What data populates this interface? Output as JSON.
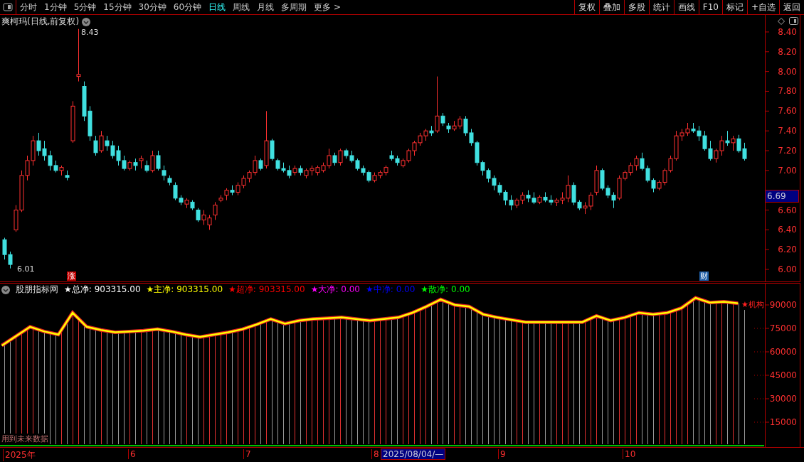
{
  "toolbar": {
    "periods": [
      {
        "label": "分时",
        "selected": false
      },
      {
        "label": "1分钟",
        "selected": false
      },
      {
        "label": "5分钟",
        "selected": false
      },
      {
        "label": "15分钟",
        "selected": false
      },
      {
        "label": "30分钟",
        "selected": false
      },
      {
        "label": "60分钟",
        "selected": false
      },
      {
        "label": "日线",
        "selected": true
      },
      {
        "label": "周线",
        "selected": false
      },
      {
        "label": "月线",
        "selected": false
      },
      {
        "label": "多周期",
        "selected": false
      }
    ],
    "more": "更多 >",
    "buttons": [
      "复权",
      "叠加",
      "多股",
      "统计",
      "画线",
      "F10",
      "标记",
      "+自选",
      "返回"
    ]
  },
  "main_chart": {
    "title": "爽柯玛(日线,前复权)",
    "current_price": "6.69",
    "high_label": "8.43",
    "low_label": "6.01",
    "markers": [
      {
        "text": "涨",
        "color": "#c00000"
      },
      {
        "text": "财",
        "color": "#1f5fa8"
      }
    ],
    "chart_data": {
      "type": "candlestick",
      "ylim": [
        5.871,
        8.572
      ],
      "yticks": [
        {
          "value": 8.4,
          "label": "8.40"
        },
        {
          "value": 8.2,
          "label": "8.20"
        },
        {
          "value": 8.0,
          "label": "8.00"
        },
        {
          "value": 7.8,
          "label": "7.80"
        },
        {
          "value": 7.6,
          "label": "7.60"
        },
        {
          "value": 7.4,
          "label": "7.40"
        },
        {
          "value": 7.2,
          "label": "7.20"
        },
        {
          "value": 7.0,
          "label": "7.00"
        },
        {
          "value": 6.6,
          "label": "6.60"
        },
        {
          "value": 6.4,
          "label": "6.40"
        },
        {
          "value": 6.2,
          "label": "6.20"
        },
        {
          "value": 6.0,
          "label": "6.00"
        }
      ],
      "ohlc": [
        [
          6.3,
          6.32,
          6.1,
          6.15
        ],
        [
          6.15,
          6.18,
          6.01,
          6.05
        ],
        [
          6.4,
          6.65,
          6.38,
          6.6
        ],
        [
          6.6,
          7.0,
          6.58,
          6.95
        ],
        [
          6.95,
          7.15,
          6.9,
          7.1
        ],
        [
          7.1,
          7.35,
          7.05,
          7.3
        ],
        [
          7.3,
          7.38,
          7.15,
          7.2
        ],
        [
          7.22,
          7.3,
          7.1,
          7.15
        ],
        [
          7.15,
          7.2,
          7.0,
          7.05
        ],
        [
          7.05,
          7.1,
          6.98,
          7.0
        ],
        [
          7.0,
          7.05,
          6.95,
          7.03
        ],
        [
          6.95,
          7.0,
          6.9,
          6.93
        ],
        [
          7.3,
          7.7,
          7.28,
          7.65
        ],
        [
          7.95,
          8.43,
          7.9,
          7.97
        ],
        [
          7.85,
          7.9,
          7.5,
          7.55
        ],
        [
          7.6,
          7.65,
          7.3,
          7.35
        ],
        [
          7.3,
          7.35,
          7.15,
          7.18
        ],
        [
          7.2,
          7.4,
          7.18,
          7.35
        ],
        [
          7.3,
          7.35,
          7.2,
          7.25
        ],
        [
          7.25,
          7.3,
          7.12,
          7.15
        ],
        [
          7.2,
          7.25,
          7.05,
          7.1
        ],
        [
          7.1,
          7.15,
          7.0,
          7.02
        ],
        [
          7.02,
          7.1,
          7.0,
          7.08
        ],
        [
          7.08,
          7.12,
          7.0,
          7.05
        ],
        [
          7.1,
          7.15,
          7.02,
          7.12
        ],
        [
          7.05,
          7.1,
          6.98,
          7.0
        ],
        [
          7.0,
          7.2,
          6.98,
          7.15
        ],
        [
          7.15,
          7.2,
          7.0,
          7.02
        ],
        [
          7.0,
          7.05,
          6.9,
          6.95
        ],
        [
          6.92,
          6.95,
          6.85,
          6.88
        ],
        [
          6.85,
          6.88,
          6.7,
          6.72
        ],
        [
          6.72,
          6.75,
          6.65,
          6.68
        ],
        [
          6.66,
          6.72,
          6.62,
          6.7
        ],
        [
          6.68,
          6.7,
          6.6,
          6.62
        ],
        [
          6.6,
          6.62,
          6.48,
          6.5
        ],
        [
          6.5,
          6.6,
          6.45,
          6.55
        ],
        [
          6.45,
          6.55,
          6.4,
          6.52
        ],
        [
          6.55,
          6.68,
          6.5,
          6.65
        ],
        [
          6.7,
          6.75,
          6.68,
          6.72
        ],
        [
          6.75,
          6.82,
          6.7,
          6.8
        ],
        [
          6.8,
          6.85,
          6.75,
          6.78
        ],
        [
          6.78,
          6.88,
          6.75,
          6.85
        ],
        [
          6.85,
          6.95,
          6.82,
          6.92
        ],
        [
          6.92,
          7.0,
          6.88,
          6.98
        ],
        [
          6.98,
          7.15,
          6.95,
          7.1
        ],
        [
          7.1,
          7.12,
          7.0,
          7.02
        ],
        [
          7.05,
          7.6,
          7.02,
          7.3
        ],
        [
          7.3,
          7.32,
          7.1,
          7.12
        ],
        [
          7.1,
          7.12,
          7.0,
          7.02
        ],
        [
          7.02,
          7.08,
          6.98,
          7.0
        ],
        [
          7.0,
          7.05,
          6.92,
          6.95
        ],
        [
          6.98,
          7.05,
          6.95,
          7.02
        ],
        [
          7.02,
          7.05,
          6.95,
          6.98
        ],
        [
          6.95,
          7.02,
          6.92,
          7.0
        ],
        [
          7.0,
          7.05,
          6.95,
          7.02
        ],
        [
          6.98,
          7.05,
          6.95,
          7.03
        ],
        [
          7.0,
          7.08,
          6.98,
          7.05
        ],
        [
          7.05,
          7.22,
          7.02,
          7.15
        ],
        [
          7.15,
          7.18,
          7.05,
          7.08
        ],
        [
          7.08,
          7.22,
          7.05,
          7.2
        ],
        [
          7.2,
          7.22,
          7.12,
          7.15
        ],
        [
          7.15,
          7.2,
          7.08,
          7.1
        ],
        [
          7.1,
          7.12,
          7.0,
          7.02
        ],
        [
          7.02,
          7.05,
          6.95,
          6.98
        ],
        [
          6.98,
          7.0,
          6.88,
          6.9
        ],
        [
          6.9,
          6.98,
          6.88,
          6.95
        ],
        [
          6.95,
          7.0,
          6.92,
          6.98
        ],
        [
          6.98,
          7.05,
          6.95,
          7.03
        ],
        [
          7.15,
          7.2,
          7.1,
          7.12
        ],
        [
          7.12,
          7.15,
          7.05,
          7.08
        ],
        [
          7.05,
          7.12,
          7.03,
          7.1
        ],
        [
          7.1,
          7.22,
          7.08,
          7.2
        ],
        [
          7.2,
          7.3,
          7.15,
          7.28
        ],
        [
          7.28,
          7.38,
          7.25,
          7.35
        ],
        [
          7.35,
          7.42,
          7.3,
          7.4
        ],
        [
          7.4,
          7.45,
          7.35,
          7.38
        ],
        [
          7.4,
          7.95,
          7.38,
          7.55
        ],
        [
          7.55,
          7.58,
          7.45,
          7.48
        ],
        [
          7.45,
          7.48,
          7.38,
          7.42
        ],
        [
          7.42,
          7.5,
          7.4,
          7.45
        ],
        [
          7.45,
          7.55,
          7.42,
          7.52
        ],
        [
          7.52,
          7.55,
          7.35,
          7.38
        ],
        [
          7.38,
          7.42,
          7.25,
          7.28
        ],
        [
          7.28,
          7.3,
          7.05,
          7.08
        ],
        [
          7.08,
          7.1,
          6.95,
          7.0
        ],
        [
          7.0,
          7.02,
          6.88,
          6.92
        ],
        [
          6.92,
          6.95,
          6.8,
          6.85
        ],
        [
          6.85,
          6.88,
          6.75,
          6.78
        ],
        [
          6.78,
          6.8,
          6.65,
          6.7
        ],
        [
          6.7,
          6.75,
          6.6,
          6.65
        ],
        [
          6.65,
          6.72,
          6.62,
          6.7
        ],
        [
          6.7,
          6.78,
          6.66,
          6.75
        ],
        [
          6.75,
          6.8,
          6.68,
          6.72
        ],
        [
          6.72,
          6.78,
          6.66,
          6.68
        ],
        [
          6.68,
          6.75,
          6.66,
          6.73
        ],
        [
          6.73,
          6.78,
          6.68,
          6.7
        ],
        [
          6.7,
          6.75,
          6.65,
          6.68
        ],
        [
          6.68,
          6.72,
          6.64,
          6.7
        ],
        [
          6.7,
          6.78,
          6.66,
          6.72
        ],
        [
          6.72,
          6.95,
          6.68,
          6.85
        ],
        [
          6.85,
          6.88,
          6.65,
          6.68
        ],
        [
          6.68,
          6.7,
          6.6,
          6.62
        ],
        [
          6.62,
          6.68,
          6.56,
          6.64
        ],
        [
          6.64,
          6.78,
          6.6,
          6.75
        ],
        [
          6.78,
          7.05,
          6.75,
          7.0
        ],
        [
          7.0,
          7.02,
          6.8,
          6.82
        ],
        [
          6.82,
          6.85,
          6.72,
          6.75
        ],
        [
          6.75,
          6.78,
          6.62,
          6.7
        ],
        [
          6.72,
          6.95,
          6.7,
          6.92
        ],
        [
          6.92,
          7.0,
          6.9,
          6.98
        ],
        [
          6.98,
          7.08,
          6.95,
          7.05
        ],
        [
          7.05,
          7.15,
          7.0,
          7.12
        ],
        [
          7.12,
          7.18,
          7.0,
          7.02
        ],
        [
          7.02,
          7.05,
          6.88,
          6.9
        ],
        [
          6.9,
          6.92,
          6.78,
          6.82
        ],
        [
          6.82,
          6.9,
          6.8,
          6.88
        ],
        [
          6.88,
          7.02,
          6.85,
          7.0
        ],
        [
          7.0,
          7.15,
          6.98,
          7.12
        ],
        [
          7.12,
          7.4,
          7.1,
          7.35
        ],
        [
          7.35,
          7.42,
          7.3,
          7.38
        ],
        [
          7.38,
          7.48,
          7.35,
          7.42
        ],
        [
          7.42,
          7.48,
          7.38,
          7.4
        ],
        [
          7.4,
          7.45,
          7.3,
          7.35
        ],
        [
          7.35,
          7.4,
          7.2,
          7.22
        ],
        [
          7.22,
          7.3,
          7.1,
          7.12
        ],
        [
          7.12,
          7.22,
          7.08,
          7.2
        ],
        [
          7.2,
          7.35,
          7.15,
          7.3
        ],
        [
          7.3,
          7.4,
          7.25,
          7.28
        ],
        [
          7.28,
          7.35,
          7.2,
          7.32
        ],
        [
          7.32,
          7.36,
          7.18,
          7.2
        ],
        [
          7.22,
          7.28,
          7.1,
          7.12
        ]
      ]
    }
  },
  "indicator": {
    "name": "股朋指标网",
    "legend": [
      {
        "label": "★总净:",
        "value": "903315.00",
        "color": "#ffffff"
      },
      {
        "label": "★主净:",
        "value": "903315.00",
        "color": "#ffff00"
      },
      {
        "label": "★超净:",
        "value": "903315.00",
        "color": "#ff0000"
      },
      {
        "label": "★大净:",
        "value": "0.00",
        "color": "#ff00ff"
      },
      {
        "label": "★中净:",
        "value": "0.00",
        "color": "#0000ff"
      },
      {
        "label": "★散净:",
        "value": "0.00",
        "color": "#00ff00"
      }
    ],
    "note": "用到未来数据",
    "chart_data": {
      "type": "line",
      "ylim": [
        -909,
        104091
      ],
      "grid": true,
      "yticks": [
        {
          "value": 90000,
          "label": "90000"
        },
        {
          "value": 75000,
          "label": "75000"
        },
        {
          "value": 60000,
          "label": "60000"
        },
        {
          "value": 45000,
          "label": "45000"
        },
        {
          "value": 30000,
          "label": "30000"
        },
        {
          "value": 15000,
          "label": "15000"
        }
      ],
      "series": [
        {
          "name": "★机构",
          "color": "#ffff00",
          "values": [
            64000,
            70000,
            76000,
            73000,
            71000,
            85000,
            76000,
            74000,
            72500,
            73000,
            73500,
            74500,
            73000,
            71000,
            69500,
            71000,
            72500,
            74500,
            77500,
            81000,
            78000,
            80000,
            81000,
            81500,
            82000,
            81000,
            80000,
            81000,
            82000,
            85000,
            89000,
            93500,
            90000,
            89000,
            84000,
            82000,
            80500,
            79000,
            79000,
            79000,
            79000,
            79000,
            83000,
            80000,
            82000,
            85000,
            84000,
            85000,
            88000,
            94500,
            91500,
            92000,
            91000
          ]
        }
      ]
    }
  },
  "date_axis": {
    "labels": [
      "2025年",
      "6",
      "7",
      "8",
      "9",
      "10"
    ],
    "cursor_date": "2025/08/04/—"
  }
}
